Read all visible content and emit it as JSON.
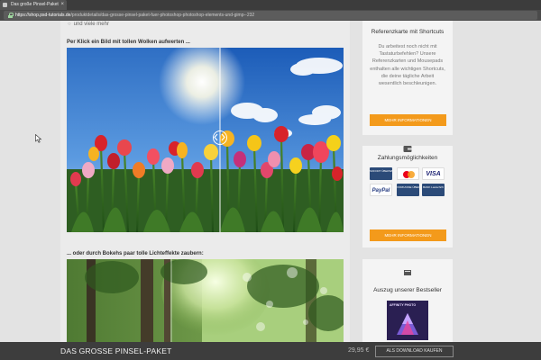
{
  "browser": {
    "tab_title": "Das große Pinsel-Paket",
    "url_host": "https://shop.psd-tutorials.de",
    "url_path": "/produktdetails/das-grosse-pinsel-paket-fuer-photoshop-photoshop-elements-und-gimp--232"
  },
  "content": {
    "list_item": "und viele mehr",
    "caption_clouds": "Per Klick ein Bild mit tollen Wolken aufwerten ...",
    "caption_bokeh": "... oder durch Bokehs paar tolle Lichteffekte zaubern:"
  },
  "sidebar": {
    "shortcuts": {
      "title": "Referenzkarte mit Shortcuts",
      "text": "Du arbeitest noch nicht mit Tastaturbefehlen? Unsere Referenzkarten und Mousepads enthalten alle wichtigen Shortcuts, die deine tägliche Arbeit wesentlich beschleunigen.",
      "button": "MEHR INFORMATIONEN"
    },
    "payment": {
      "title": "Zahlungsmöglichkeiten",
      "methods": [
        "SOFORT ÜBERWEISUNG",
        "mastercard",
        "VISA",
        "PayPal",
        "VORKASSE ÜBERWEISUNG",
        "BANK Lastschrift"
      ],
      "button": "MEHR INFORMATIONEN"
    },
    "bestseller": {
      "title": "Auszug unserer Bestseller",
      "product_label": "AFFINITY PHOTO"
    }
  },
  "footer": {
    "title": "DAS GROSSE PINSEL-PAKET",
    "price": "29,95 €",
    "button": "ALS DOWNLOAD KAUFEN"
  },
  "colors": {
    "accent_orange": "#f39a1b",
    "footer_bg": "#3d3d3d",
    "sky_blue": "#2f6fc4"
  },
  "icons": {
    "compare_slider": "compare-handle-icon",
    "shortcuts_box": "keyboard-icon",
    "payment_box": "wallet-icon",
    "bestseller_box": "book-icon"
  }
}
